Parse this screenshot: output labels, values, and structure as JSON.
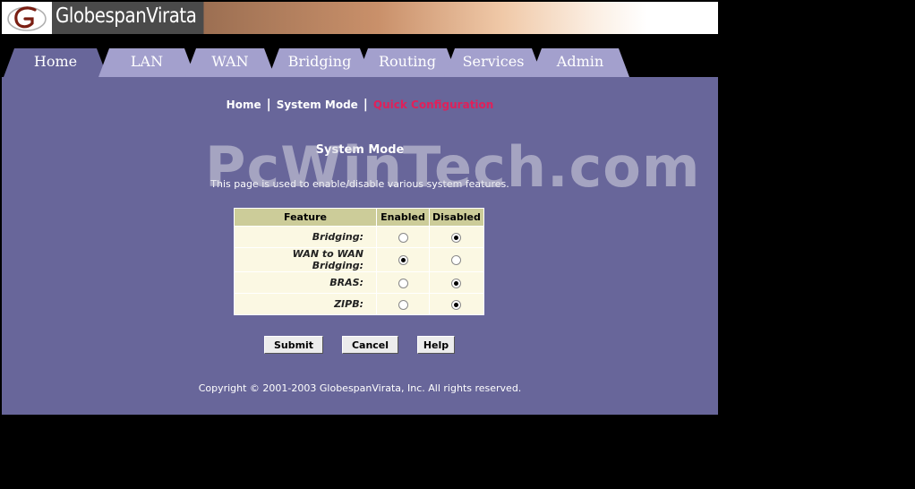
{
  "brand": {
    "name": "GlobespanVirata"
  },
  "tabs": [
    {
      "label": "Home",
      "active": true
    },
    {
      "label": "LAN",
      "active": false
    },
    {
      "label": "WAN",
      "active": false
    },
    {
      "label": "Bridging",
      "active": false
    },
    {
      "label": "Routing",
      "active": false
    },
    {
      "label": "Services",
      "active": false
    },
    {
      "label": "Admin",
      "active": false
    }
  ],
  "breadcrumb": {
    "items": [
      "Home",
      "System Mode",
      "Quick Configuration"
    ],
    "separator": "|"
  },
  "page": {
    "heading": "System Mode",
    "description": "This page is used to enable/disable various system features."
  },
  "table": {
    "headers": {
      "feature": "Feature",
      "enabled": "Enabled",
      "disabled": "Disabled"
    },
    "rows": [
      {
        "label": "Bridging:",
        "selected": "disabled"
      },
      {
        "label": "WAN to WAN Bridging:",
        "selected": "enabled"
      },
      {
        "label": "BRAS:",
        "selected": "disabled"
      },
      {
        "label": "ZIPB:",
        "selected": "disabled"
      }
    ]
  },
  "buttons": {
    "submit": "Submit",
    "cancel": "Cancel",
    "help": "Help"
  },
  "footer": {
    "copyright": "Copyright © 2001-2003 GlobespanVirata, Inc. All rights reserved."
  },
  "watermark": "PcWinTech.com",
  "colors": {
    "panel": "#68669a",
    "tab_inactive": "#a3a0cd",
    "table_header": "#cccc99",
    "table_cell": "#fbf8e3",
    "breadcrumb_current": "#e0205a"
  }
}
